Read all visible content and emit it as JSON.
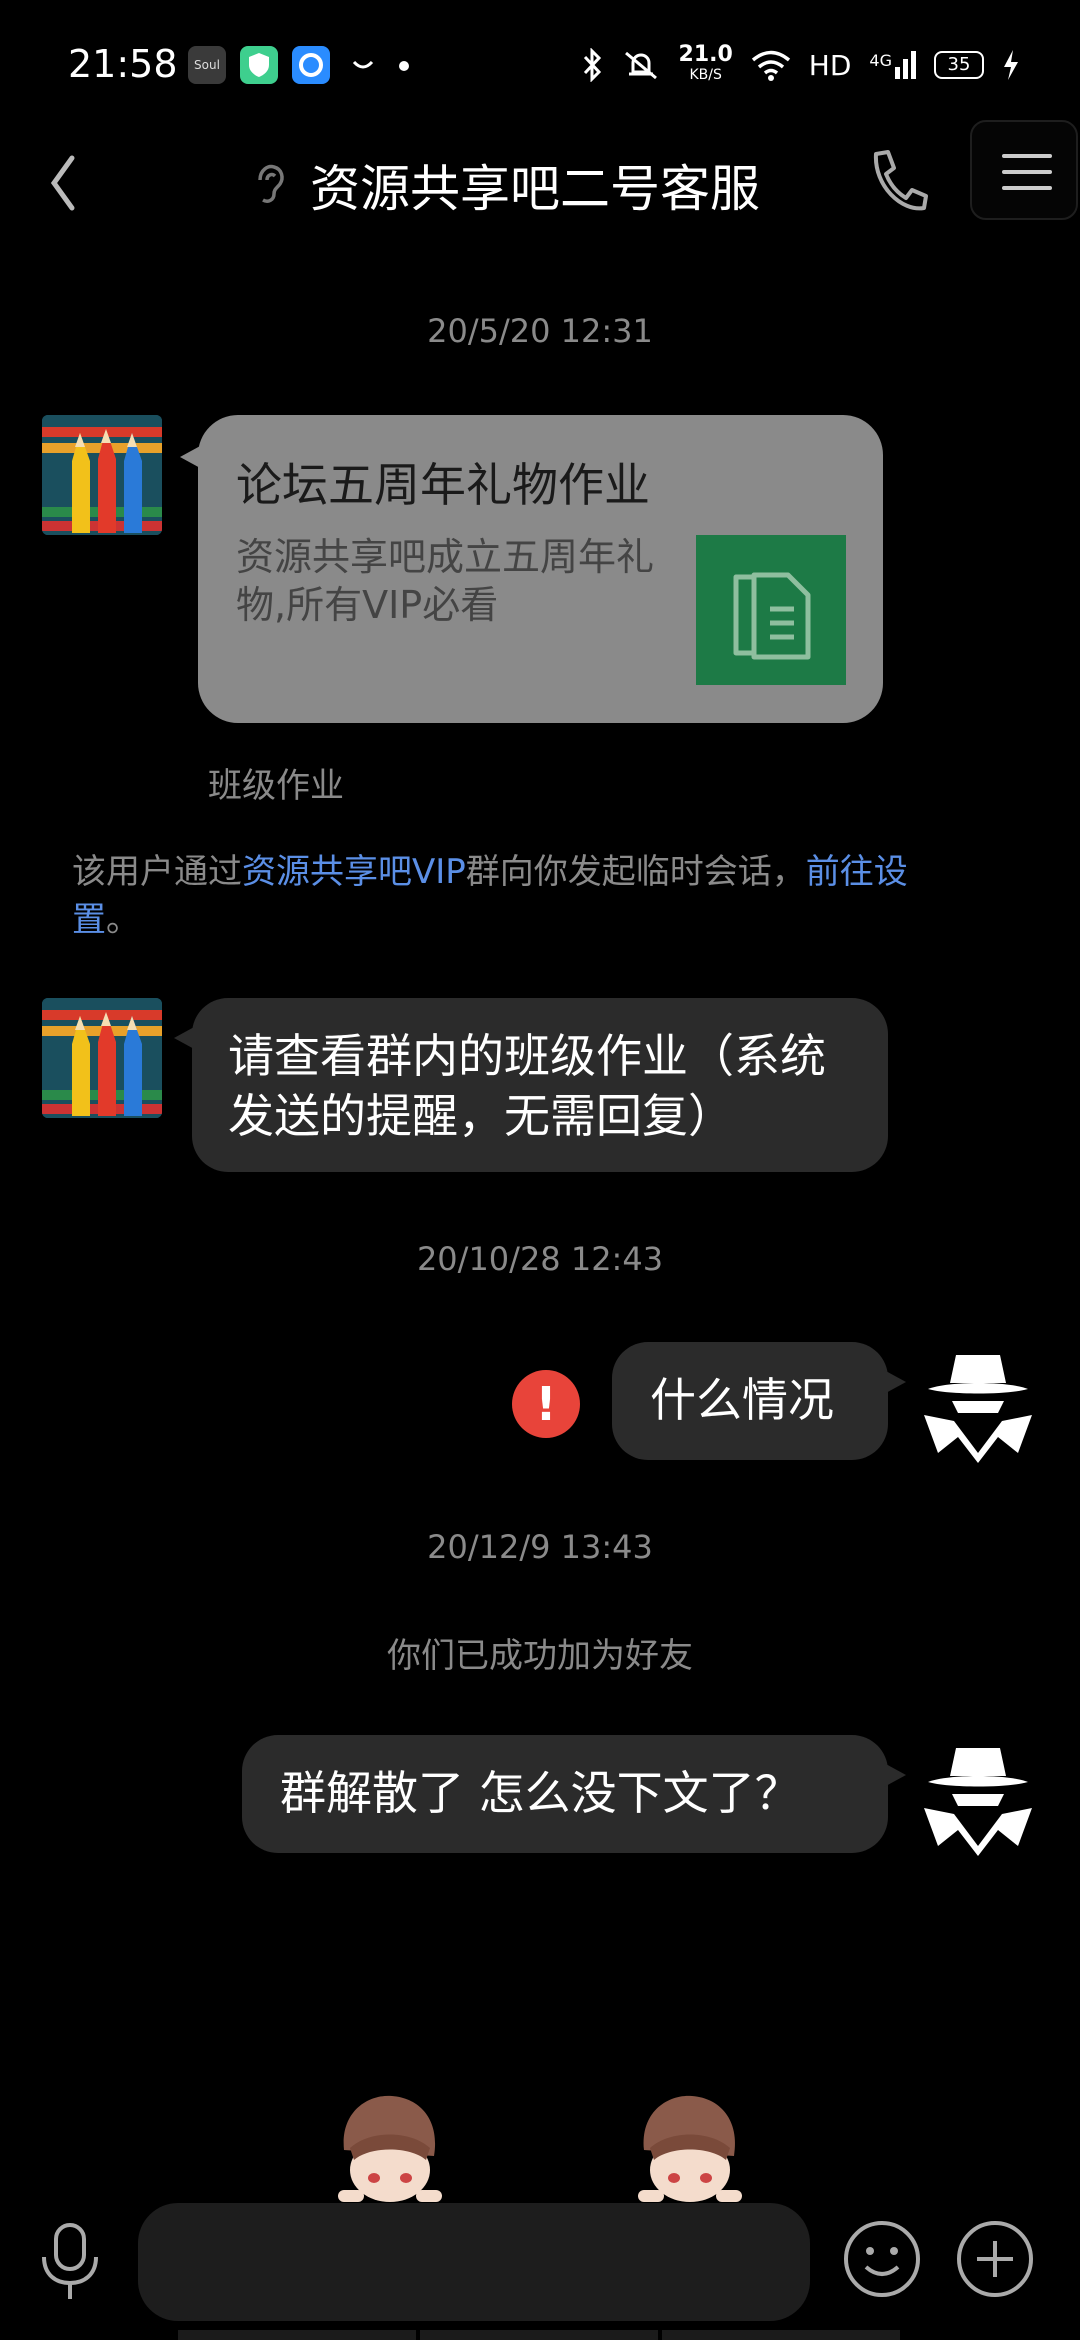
{
  "status_bar": {
    "time": "21:58",
    "soul_label": "Soul",
    "speed": "21.0",
    "speed_unit": "KB/S",
    "hd": "HD",
    "network": "4G",
    "battery": "35"
  },
  "header": {
    "title": "资源共享吧二号客服"
  },
  "messages": {
    "ts1": "20/5/20 12:31",
    "card": {
      "title": "论坛五周年礼物作业",
      "description": "资源共享吧成立五周年礼物,所有VIP必看",
      "source": "班级作业"
    },
    "sys_note": {
      "prefix": "该用户通过",
      "group_link": "资源共享吧VIP",
      "middle": "群向你发起临时会话，",
      "settings_link": "前往设置",
      "suffix": "。"
    },
    "msg1": "请查看群内的班级作业（系统发送的提醒，无需回复）",
    "ts2": "20/10/28 12:43",
    "msg2": "什么情况",
    "error_mark": "!",
    "ts3": "20/12/9 13:43",
    "friend_note": "你们已成功加为好友",
    "msg3": "群解散了 怎么没下文了？"
  },
  "input_bar": {
    "placeholder": ""
  },
  "colors": {
    "background": "#000000",
    "bubble": "#2b2b2b",
    "link": "#5b8fe6",
    "error": "#e8443a",
    "card_thumb": "#1d7a46"
  }
}
